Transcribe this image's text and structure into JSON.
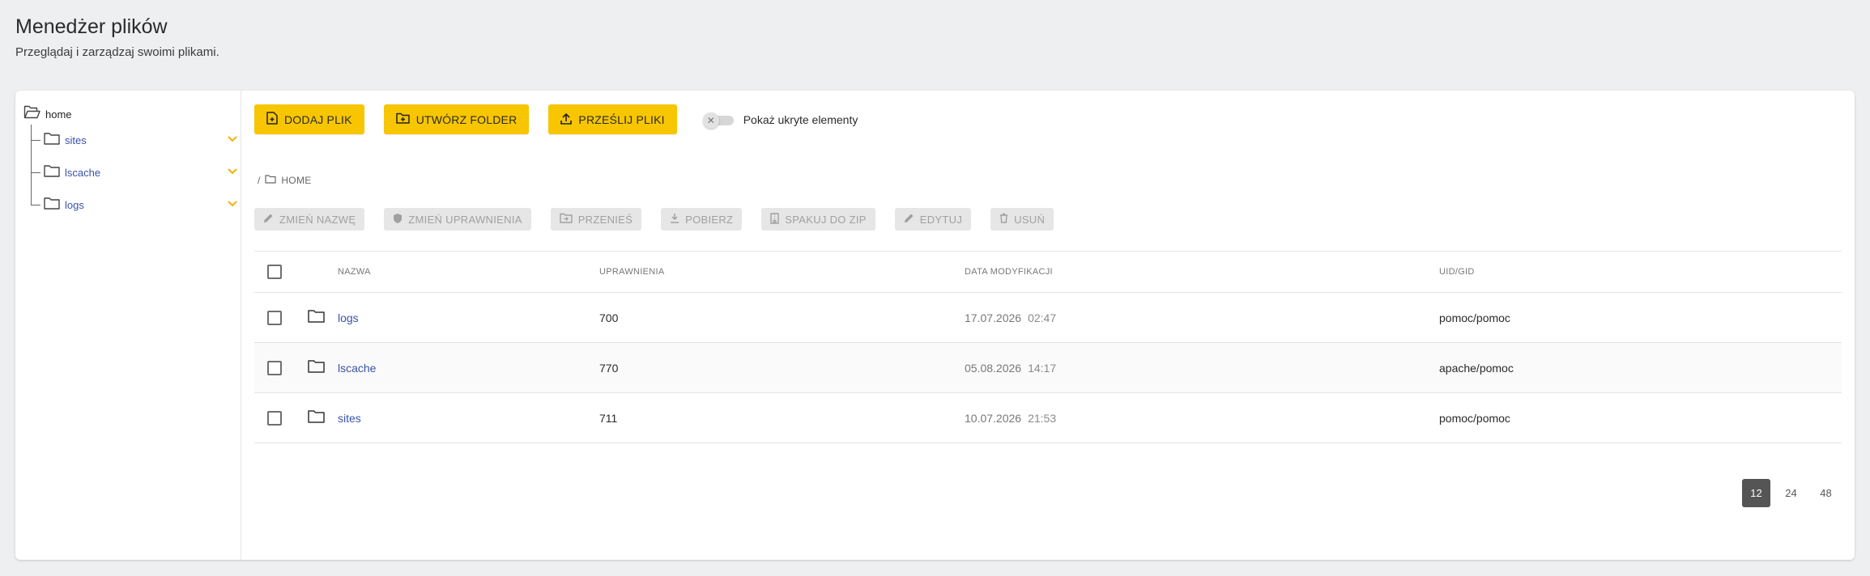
{
  "header": {
    "title": "Menedżer plików",
    "subtitle": "Przeglądaj i zarządzaj swoimi plikami."
  },
  "sidebar": {
    "root": "home",
    "items": [
      {
        "label": "sites"
      },
      {
        "label": "lscache"
      },
      {
        "label": "logs"
      }
    ]
  },
  "toolbar": {
    "add_file": "DODAJ PLIK",
    "create_folder": "UTWÓRZ FOLDER",
    "upload_files": "PRZEŚLIJ PLIKI",
    "show_hidden": "Pokaż ukryte elementy",
    "show_hidden_on": false
  },
  "breadcrumb": {
    "separator": "/",
    "current": "HOME"
  },
  "actions": {
    "rename": "ZMIEŃ NAZWĘ",
    "permissions": "ZMIEŃ UPRAWNIENIA",
    "move": "PRZENIEŚ",
    "download": "POBIERZ",
    "zip": "SPAKUJ DO ZIP",
    "edit": "EDYTUJ",
    "delete": "USUŃ"
  },
  "table": {
    "columns": {
      "name": "NAZWA",
      "permissions": "UPRAWNIENIA",
      "modified": "DATA MODYFIKACJI",
      "uid": "UID/GID"
    },
    "rows": [
      {
        "name": "logs",
        "permissions": "700",
        "date": "17.07.2026",
        "time": "02:47",
        "uid": "pomoc/pomoc"
      },
      {
        "name": "lscache",
        "permissions": "770",
        "date": "05.08.2026",
        "time": "14:17",
        "uid": "apache/pomoc"
      },
      {
        "name": "sites",
        "permissions": "711",
        "date": "10.07.2026",
        "time": "21:53",
        "uid": "pomoc/pomoc"
      }
    ]
  },
  "pagination": {
    "sizes": [
      "12",
      "24",
      "48"
    ],
    "active": "12"
  },
  "colors": {
    "accent": "#f7c600",
    "link": "#3a52a8"
  }
}
